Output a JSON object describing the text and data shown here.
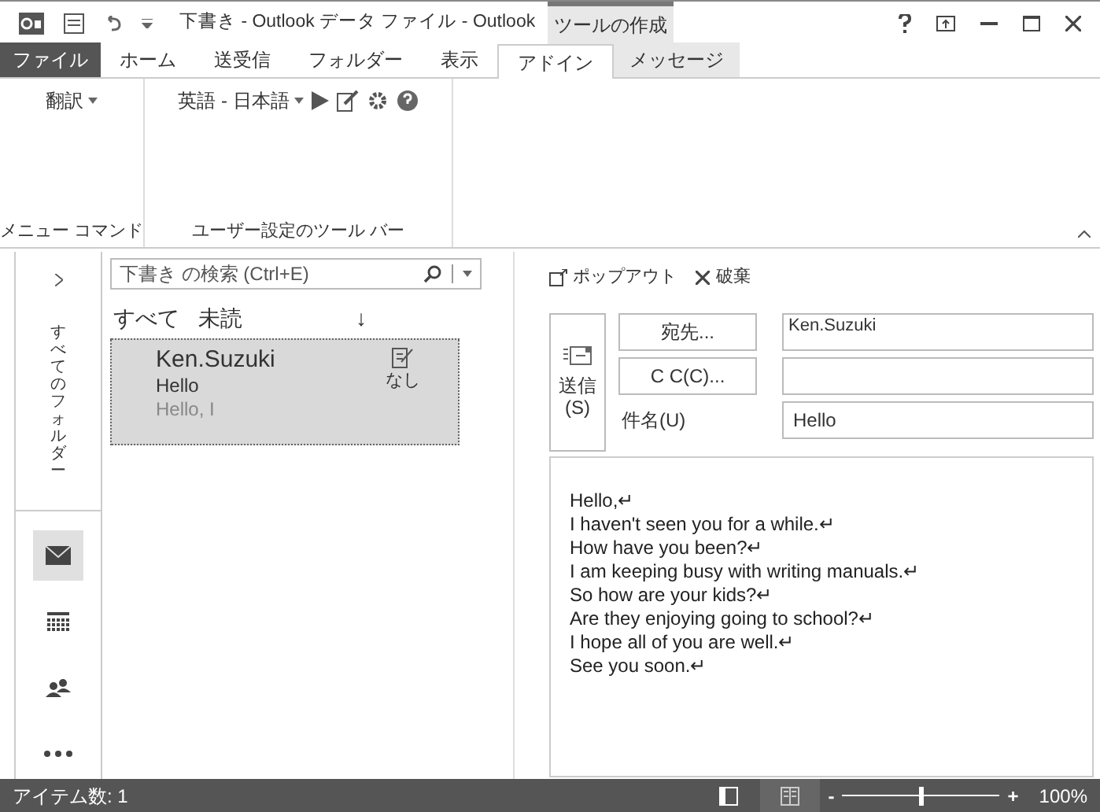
{
  "window": {
    "title": "下書き - Outlook データ ファイル - Outlook",
    "context_title": "ツールの作成"
  },
  "tabs": [
    {
      "label": "ファイル",
      "kind": "file",
      "selected": false
    },
    {
      "label": "ホーム",
      "kind": "normal",
      "selected": false
    },
    {
      "label": "送受信",
      "kind": "normal",
      "selected": false
    },
    {
      "label": "フォルダー",
      "kind": "normal",
      "selected": false
    },
    {
      "label": "表示",
      "kind": "normal",
      "selected": false
    },
    {
      "label": "アドイン",
      "kind": "normal",
      "selected": true
    },
    {
      "label": "メッセージ",
      "kind": "contextual",
      "selected": false
    }
  ],
  "ribbon": {
    "groups": [
      {
        "label": "メニュー コマンド",
        "items": [
          "翻訳"
        ]
      },
      {
        "label": "ユーザー設定のツール バー",
        "items": [
          "英語 - 日本語"
        ]
      }
    ]
  },
  "nav": {
    "folder_label": "すべてのフォルダー",
    "items": [
      {
        "kind": "mail",
        "selected": true
      },
      {
        "kind": "calendar",
        "selected": false
      },
      {
        "kind": "people",
        "selected": false
      },
      {
        "kind": "more",
        "selected": false
      }
    ]
  },
  "list": {
    "search_placeholder": "下書き の検索 (Ctrl+E)",
    "filters": [
      "すべて",
      "未読"
    ],
    "sort_arrow": "↓",
    "items": [
      {
        "sender": "Ken.Suzuki",
        "subject": "Hello",
        "preview": "Hello, I",
        "category": "なし",
        "selected": true
      }
    ]
  },
  "compose": {
    "popout": "ポップアウト",
    "discard": "破棄",
    "send": "送信\n(S)",
    "to_button": "宛先...",
    "to_value": "Ken.Suzuki",
    "cc_button": "C C(C)...",
    "subject_label": "件名(U)",
    "subject_value": "Hello",
    "body": [
      "Hello,↵",
      "I haven't seen you for a while.↵",
      "How have you been?↵",
      "I am keeping busy with writing manuals.↵",
      "So how are your kids?↵",
      "Are they enjoying going to school?↵",
      "I hope all of you are well.↵",
      "See you soon.↵"
    ]
  },
  "status_bar": {
    "items": "アイテム数: 1",
    "zoom": {
      "level": 0.5,
      "minus": "-",
      "plus": "+",
      "reading": "100%"
    }
  }
}
